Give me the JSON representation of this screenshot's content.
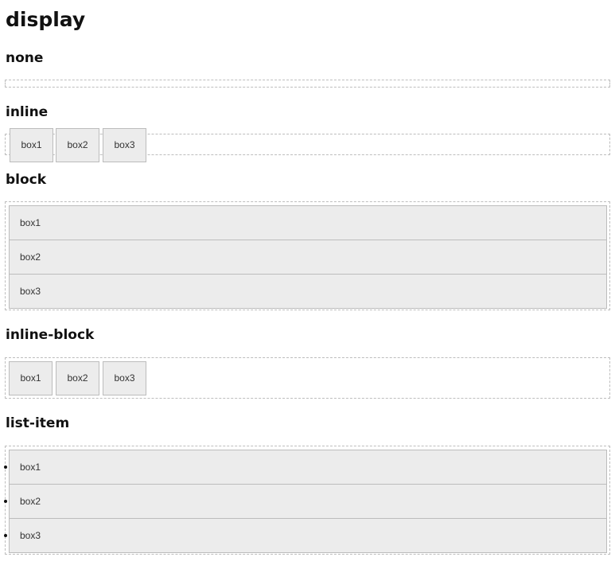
{
  "page": {
    "title": "display"
  },
  "sections": [
    {
      "heading": "none",
      "boxes": []
    },
    {
      "heading": "inline",
      "boxes": [
        "box1",
        "box2",
        "box3"
      ]
    },
    {
      "heading": "block",
      "boxes": [
        "box1",
        "box2",
        "box3"
      ]
    },
    {
      "heading": "inline-block",
      "boxes": [
        "box1",
        "box2",
        "box3"
      ]
    },
    {
      "heading": "list-item",
      "boxes": [
        "box1",
        "box2",
        "box3"
      ]
    }
  ]
}
